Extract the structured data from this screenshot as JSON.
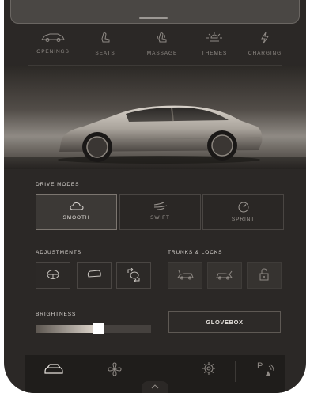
{
  "top_nav": {
    "items": [
      {
        "label": "OPENINGS",
        "icon": "car-openings-icon"
      },
      {
        "label": "SEATS",
        "icon": "seat-icon"
      },
      {
        "label": "MASSAGE",
        "icon": "massage-seat-icon"
      },
      {
        "label": "THEMES",
        "icon": "sun-lamp-icon"
      },
      {
        "label": "CHARGING",
        "icon": "lightning-icon"
      }
    ]
  },
  "drive_modes": {
    "title": "DRIVE MODES",
    "items": [
      {
        "label": "SMOOTH",
        "icon": "cloud-icon",
        "active": true
      },
      {
        "label": "SWIFT",
        "icon": "wind-icon",
        "active": false
      },
      {
        "label": "SPRINT",
        "icon": "speedometer-icon",
        "active": false
      }
    ]
  },
  "adjustments": {
    "title": "ADJUSTMENTS",
    "items": [
      "steering-wheel-icon",
      "mirror-icon",
      "steering-column-icon"
    ]
  },
  "trunks_locks": {
    "title": "TRUNKS & LOCKS",
    "items": [
      "frunk-icon",
      "trunk-icon",
      "lock-icon"
    ]
  },
  "brightness": {
    "title": "BRIGHTNESS",
    "level": 0.55
  },
  "glovebox": {
    "label": "GLOVEBOX"
  },
  "bottom_bar": {
    "items": [
      "car-icon",
      "fan-icon",
      "gear-icon",
      "park-assist-icon"
    ],
    "park_label": "P"
  },
  "colors": {
    "background": "#2b2826",
    "accent_text": "#e2ded9",
    "muted_text": "#8f8a85"
  }
}
